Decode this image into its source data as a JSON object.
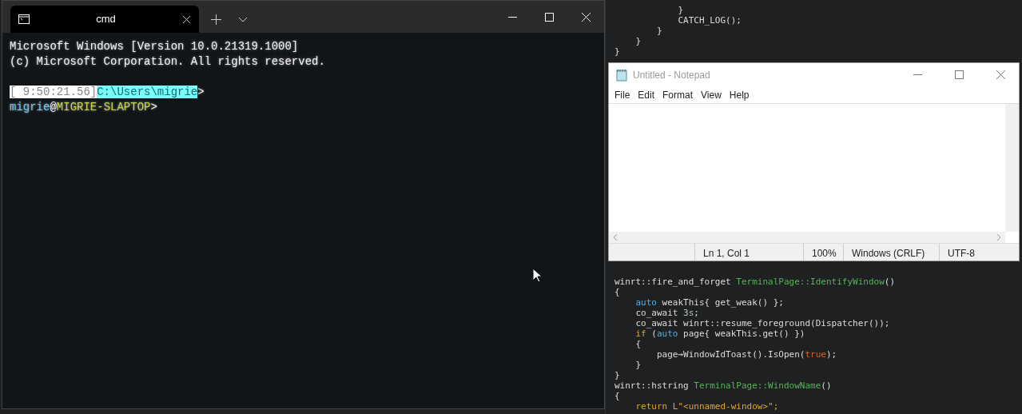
{
  "editor": {
    "top_lines": [
      [
        {
          "text": "            }",
          "kind": "plain"
        }
      ],
      [
        {
          "text": "            CATCH_LOG();",
          "kind": "plain"
        }
      ],
      [
        {
          "text": "        }",
          "kind": "plain"
        }
      ],
      [
        {
          "text": "    }",
          "kind": "plain"
        }
      ],
      [
        {
          "text": "}",
          "kind": "plain"
        }
      ]
    ],
    "bottom_lines": [
      [
        {
          "text": "winrt::fire_and_forget ",
          "kind": "plain"
        },
        {
          "text": "TerminalPage::IdentifyWindow",
          "kind": "type"
        },
        {
          "text": "()",
          "kind": "plain"
        }
      ],
      [
        {
          "text": "{",
          "kind": "plain"
        }
      ],
      [
        {
          "text": "    auto",
          "kind": "keyword"
        },
        {
          "text": " weakThis{ get_weak() };",
          "kind": "plain"
        }
      ],
      [
        {
          "text": "    co_await ",
          "kind": "plain"
        },
        {
          "text": "3s",
          "kind": "number"
        },
        {
          "text": ";",
          "kind": "plain"
        }
      ],
      [
        {
          "text": "    co_await winrt::resume_foreground(Dispatcher());",
          "kind": "plain"
        }
      ],
      [
        {
          "text": "    if",
          "kind": "control"
        },
        {
          "text": " (",
          "kind": "plain"
        },
        {
          "text": "auto",
          "kind": "keyword"
        },
        {
          "text": " page{ weakThis.get() })",
          "kind": "plain"
        }
      ],
      [
        {
          "text": "    {",
          "kind": "plain"
        }
      ],
      [
        {
          "text": "        page→WindowIdToast().IsOpen(",
          "kind": "plain"
        },
        {
          "text": "true",
          "kind": "literal"
        },
        {
          "text": ");",
          "kind": "plain"
        }
      ],
      [
        {
          "text": "    }",
          "kind": "plain"
        }
      ],
      [
        {
          "text": "}",
          "kind": "plain"
        }
      ],
      [
        {
          "text": "winrt::hstring ",
          "kind": "plain"
        },
        {
          "text": "TerminalPage::WindowName",
          "kind": "type"
        },
        {
          "text": "()",
          "kind": "plain"
        }
      ],
      [
        {
          "text": "{",
          "kind": "plain"
        }
      ],
      [
        {
          "text": "    return",
          "kind": "control"
        },
        {
          "text": " L\"<unnamed-window>\";",
          "kind": "control"
        }
      ]
    ]
  },
  "terminal": {
    "tabs": [
      {
        "label": "cmd",
        "selected": true
      }
    ],
    "banner": [
      [
        {
          "text": "Microsoft Windows [Version 10.0.21319.1000]",
          "kind": "plain"
        }
      ],
      [
        {
          "text": "(c) Microsoft Corporation. All rights reserved.",
          "kind": "plain"
        }
      ]
    ],
    "prompt": [
      [
        {
          "text": "[ 9:50:21.56]",
          "kind": "time"
        },
        {
          "text": "C:\\Users\\migrie",
          "kind": "path"
        },
        {
          "text": ">",
          "kind": "plain"
        }
      ],
      [
        {
          "text": "migrie",
          "kind": "user"
        },
        {
          "text": "@",
          "kind": "plain"
        },
        {
          "text": "MIGRIE-SLAPTOP",
          "kind": "host"
        },
        {
          "text": ">",
          "kind": "plain"
        }
      ]
    ]
  },
  "notepad": {
    "title": "Untitled - Notepad",
    "menu": [
      "File",
      "Edit",
      "Format",
      "View",
      "Help"
    ],
    "status_bar": [
      "Ln 1, Col 1",
      "100%",
      "Windows (CRLF)",
      "UTF-8"
    ]
  }
}
